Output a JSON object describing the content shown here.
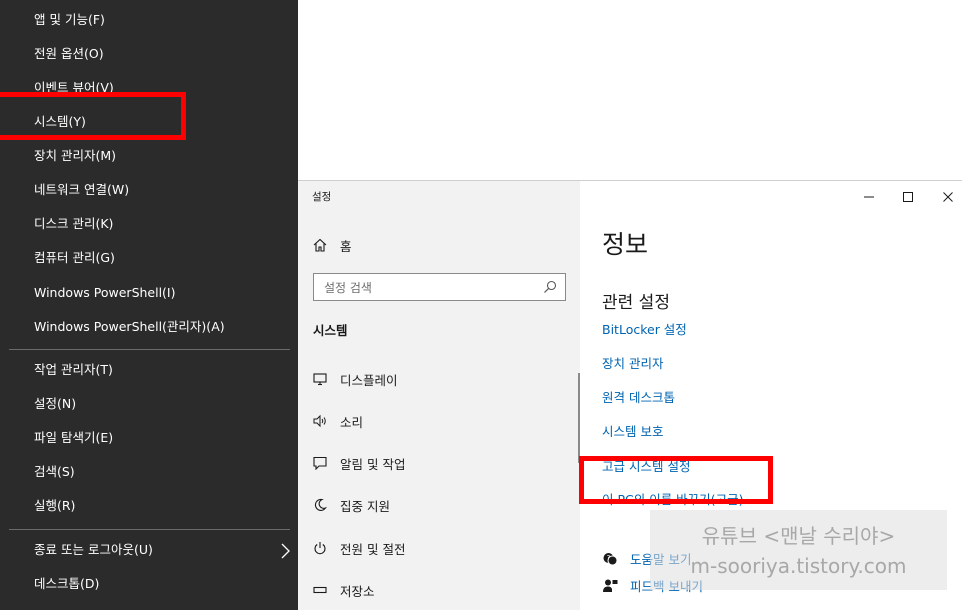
{
  "winx_menu": {
    "group1": [
      "앱 및 기능(F)",
      "전원 옵션(O)",
      "이벤트 뷰어(V)",
      "시스템(Y)",
      "장치 관리자(M)",
      "네트워크 연결(W)",
      "디스크 관리(K)",
      "컴퓨터 관리(G)",
      "Windows PowerShell(I)",
      "Windows PowerShell(관리자)(A)"
    ],
    "group2": [
      "작업 관리자(T)",
      "설정(N)",
      "파일 탐색기(E)",
      "검색(S)",
      "실행(R)"
    ],
    "group3": [
      "종료 또는 로그아웃(U)",
      "데스크톱(D)"
    ]
  },
  "settings": {
    "window_title": "설정",
    "home_label": "홈",
    "search_placeholder": "설정 검색",
    "section_title": "시스템",
    "nav_items": [
      {
        "label": "디스플레이",
        "icon": "display-icon"
      },
      {
        "label": "소리",
        "icon": "speaker-icon"
      },
      {
        "label": "알림 및 작업",
        "icon": "notification-icon"
      },
      {
        "label": "집중 지원",
        "icon": "moon-icon"
      },
      {
        "label": "전원 및 절전",
        "icon": "power-icon"
      },
      {
        "label": "저장소",
        "icon": "storage-icon"
      }
    ],
    "page_title": "정보",
    "related_title": "관련 설정",
    "related_links": [
      "BitLocker 설정",
      "장치 관리자",
      "원격 데스크톱",
      "시스템 보호",
      "고급 시스템 설정",
      "이 PC의 이름 바꾸기(고급)"
    ],
    "help_links": [
      {
        "label": "도움말 보기",
        "icon": "help-chat-icon"
      },
      {
        "label": "피드백 보내기",
        "icon": "feedback-icon"
      }
    ]
  },
  "watermark": {
    "line1": "유튜브 <맨날 수리야>",
    "line2": "m-sooriya.tistory.com"
  },
  "colors": {
    "menu_bg": "#2b2b2b",
    "link": "#0063b1",
    "highlight": "#ff0000",
    "nav_bg": "#f2f2f2"
  }
}
